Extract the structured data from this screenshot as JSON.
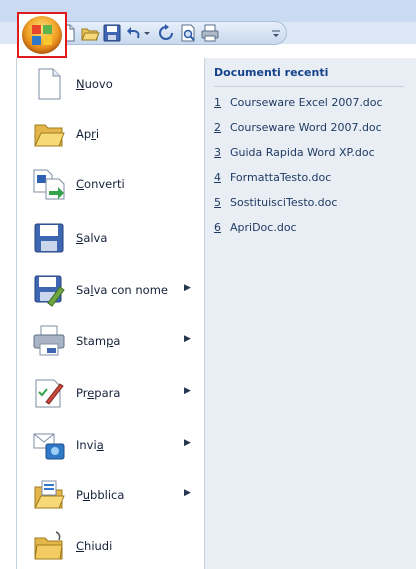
{
  "quick_access": {
    "icons": [
      "new-document-icon",
      "open-folder-icon",
      "save-icon",
      "undo-icon",
      "undo-dropdown-icon",
      "redo-icon",
      "print-preview-icon",
      "print-icon",
      "customize-qat-icon"
    ]
  },
  "menu": {
    "items": [
      {
        "pre": "",
        "key": "N",
        "post": "uovo",
        "icon": "new-document-icon",
        "submenu": false
      },
      {
        "pre": "Ap",
        "key": "r",
        "post": "i",
        "icon": "open-folder-icon",
        "submenu": false
      },
      {
        "pre": "",
        "key": "C",
        "post": "onverti",
        "icon": "convert-document-icon",
        "submenu": false
      },
      {
        "pre": "",
        "key": "S",
        "post": "alva",
        "icon": "save-icon",
        "submenu": false
      },
      {
        "pre": "Sa",
        "key": "l",
        "post": "va con nome",
        "icon": "save-as-icon",
        "submenu": true
      },
      {
        "pre": "Stam",
        "key": "p",
        "post": "a",
        "icon": "print-icon",
        "submenu": true
      },
      {
        "pre": "Pr",
        "key": "e",
        "post": "para",
        "icon": "prepare-icon",
        "submenu": true
      },
      {
        "pre": "Invi",
        "key": "a",
        "post": "",
        "icon": "send-icon",
        "submenu": true
      },
      {
        "pre": "P",
        "key": "u",
        "post": "bblica",
        "icon": "publish-icon",
        "submenu": true
      },
      {
        "pre": "",
        "key": "C",
        "post": "hiudi",
        "icon": "close-folder-icon",
        "submenu": false
      }
    ],
    "submenu_arrow": "▶"
  },
  "recent": {
    "title": "Documenti recenti",
    "items": [
      {
        "num": "1",
        "name": "Courseware Excel 2007.doc"
      },
      {
        "num": "2",
        "name": "Courseware Word 2007.doc"
      },
      {
        "num": "3",
        "name": "Guida Rapida Word XP.doc"
      },
      {
        "num": "4",
        "name": "FormattaTesto.doc"
      },
      {
        "num": "5",
        "name": "SostituisciTesto.doc"
      },
      {
        "num": "6",
        "name": "ApriDoc.doc"
      }
    ]
  },
  "colors": {
    "highlight_border": "#e01b1b",
    "accent_orange": "#f2a52a",
    "panel_bg": "#e9eef5",
    "title_blue": "#15428b"
  }
}
